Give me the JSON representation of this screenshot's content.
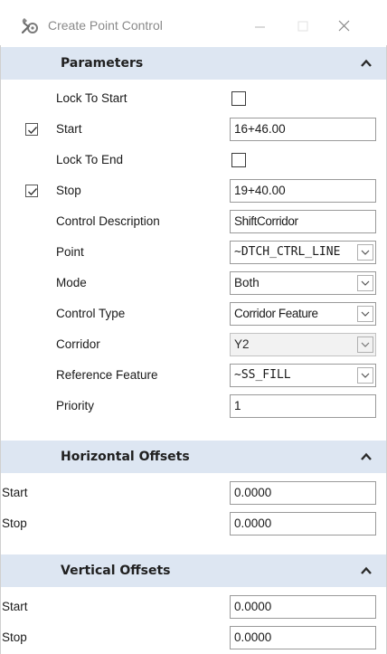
{
  "window": {
    "title": "Create Point Control",
    "icon": "wrench-settings-icon"
  },
  "parameters": {
    "title": "Parameters",
    "rows": {
      "lock_to_start": {
        "label": "Lock To Start",
        "checked": false
      },
      "start": {
        "label": "Start",
        "checked": true,
        "value": "16+46.00"
      },
      "lock_to_end": {
        "label": "Lock To End",
        "checked": false
      },
      "stop": {
        "label": "Stop",
        "checked": true,
        "value": "19+40.00"
      },
      "control_description": {
        "label": "Control Description",
        "value": "ShiftCorridor"
      },
      "point": {
        "label": "Point",
        "value": "~DTCH_CTRL_LINE"
      },
      "mode": {
        "label": "Mode",
        "value": "Both"
      },
      "control_type": {
        "label": "Control Type",
        "value": "Corridor Feature"
      },
      "corridor": {
        "label": "Corridor",
        "value": "Y2"
      },
      "reference_feature": {
        "label": "Reference Feature",
        "value": "~SS_FILL"
      },
      "priority": {
        "label": "Priority",
        "value": "1"
      }
    }
  },
  "horizontal_offsets": {
    "title": "Horizontal Offsets",
    "start": {
      "label": "Start",
      "value": "0.0000"
    },
    "stop": {
      "label": "Stop",
      "value": "0.0000"
    }
  },
  "vertical_offsets": {
    "title": "Vertical Offsets",
    "start": {
      "label": "Start",
      "value": "0.0000"
    },
    "stop": {
      "label": "Stop",
      "value": "0.0000"
    }
  },
  "colors": {
    "section_header_bg": "#dde6f2",
    "field_border": "#9a9a9a",
    "disabled_field_bg": "#f2f2f2"
  }
}
